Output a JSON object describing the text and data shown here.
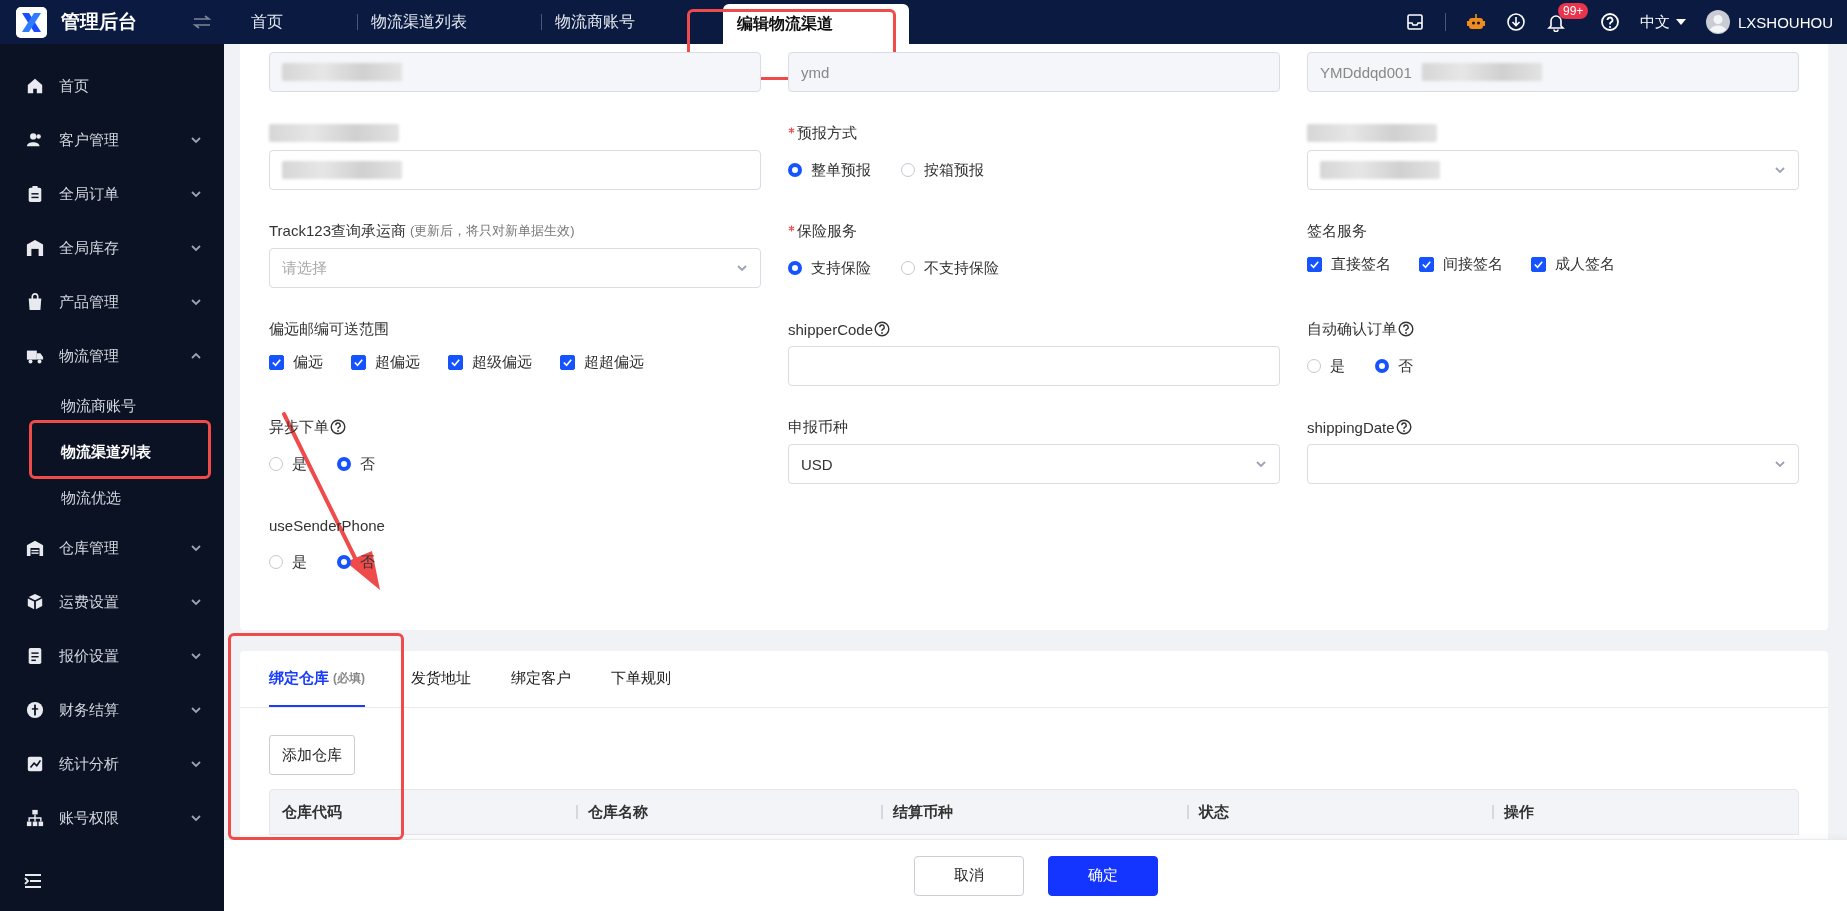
{
  "topbar": {
    "app_name": "管理后台",
    "tabs": [
      {
        "label": "首页",
        "selected": false
      },
      {
        "label": "物流渠道列表",
        "selected": false
      },
      {
        "label": "物流商账号",
        "selected": false
      },
      {
        "label": "编辑物流渠道",
        "selected": true
      }
    ],
    "notification_badge": "99+",
    "language": "中文",
    "username": "LXSHOUHOU"
  },
  "sidebar": {
    "items": [
      {
        "label": "首页",
        "kind": "link"
      },
      {
        "label": "客户管理",
        "kind": "group",
        "expanded": false
      },
      {
        "label": "全局订单",
        "kind": "group",
        "expanded": false
      },
      {
        "label": "全局库存",
        "kind": "group",
        "expanded": false
      },
      {
        "label": "产品管理",
        "kind": "group",
        "expanded": false
      },
      {
        "label": "物流管理",
        "kind": "group",
        "expanded": true,
        "children": [
          {
            "label": "物流商账号",
            "selected": false
          },
          {
            "label": "物流渠道列表",
            "selected": true
          },
          {
            "label": "物流优选",
            "selected": false
          }
        ]
      },
      {
        "label": "仓库管理",
        "kind": "group",
        "expanded": false
      },
      {
        "label": "运费设置",
        "kind": "group",
        "expanded": false
      },
      {
        "label": "报价设置",
        "kind": "group",
        "expanded": false
      },
      {
        "label": "财务结算",
        "kind": "group",
        "expanded": false
      },
      {
        "label": "统计分析",
        "kind": "group",
        "expanded": false
      },
      {
        "label": "账号权限",
        "kind": "group",
        "expanded": false
      }
    ]
  },
  "form": {
    "fields": [
      {
        "kind": "input",
        "disabled": true,
        "redacted": true
      },
      {
        "kind": "input",
        "disabled": true,
        "value": "ymd"
      },
      {
        "kind": "input",
        "disabled": true,
        "value": "YMDddqd001",
        "redacted": true
      },
      {
        "kind": "input",
        "label_redacted": true,
        "redacted": true
      },
      {
        "kind": "radio",
        "label": "预报方式",
        "required": true,
        "options": [
          {
            "label": "整单预报",
            "selected": true
          },
          {
            "label": "按箱预报",
            "selected": false
          }
        ]
      },
      {
        "kind": "select",
        "label_redacted": true,
        "redacted": true
      },
      {
        "kind": "select",
        "label": "Track123查询承运商",
        "hint": "(更新后，将只对新单据生效)",
        "placeholder": "请选择"
      },
      {
        "kind": "radio",
        "label": "保险服务",
        "required": true,
        "options": [
          {
            "label": "支持保险",
            "selected": true
          },
          {
            "label": "不支持保险",
            "selected": false
          }
        ]
      },
      {
        "kind": "checkbox",
        "label": "签名服务",
        "options": [
          {
            "label": "直接签名",
            "checked": true
          },
          {
            "label": "间接签名",
            "checked": true
          },
          {
            "label": "成人签名",
            "checked": true
          }
        ]
      },
      {
        "kind": "checkbox",
        "label": "偏远邮编可送范围",
        "options": [
          {
            "label": "偏远",
            "checked": true
          },
          {
            "label": "超偏远",
            "checked": true
          },
          {
            "label": "超级偏远",
            "checked": true
          },
          {
            "label": "超超偏远",
            "checked": true
          }
        ]
      },
      {
        "kind": "input",
        "label": "shipperCode",
        "help": true
      },
      {
        "kind": "radio",
        "label": "自动确认订单",
        "help": true,
        "options": [
          {
            "label": "是",
            "selected": false
          },
          {
            "label": "否",
            "selected": true
          }
        ]
      },
      {
        "kind": "radio",
        "label": "异步下单",
        "help": true,
        "options": [
          {
            "label": "是",
            "selected": false
          },
          {
            "label": "否",
            "selected": true
          }
        ]
      },
      {
        "kind": "select",
        "label": "申报币种",
        "value": "USD"
      },
      {
        "kind": "select",
        "label": "shippingDate",
        "help": true
      },
      {
        "kind": "radio",
        "label": "useSenderPhone",
        "options": [
          {
            "label": "是",
            "selected": false
          },
          {
            "label": "否",
            "selected": true
          }
        ]
      }
    ]
  },
  "binding": {
    "tabs": [
      {
        "label": "绑定仓库",
        "note": "(必填)",
        "selected": true
      },
      {
        "label": "发货地址",
        "selected": false
      },
      {
        "label": "绑定客户",
        "selected": false
      },
      {
        "label": "下单规则",
        "selected": false
      }
    ],
    "add_button": "添加仓库",
    "table": {
      "columns": [
        "仓库代码",
        "仓库名称",
        "结算币种",
        "状态",
        "操作"
      ]
    }
  },
  "footer": {
    "buttons": [
      {
        "label": "取消",
        "kind": "default"
      },
      {
        "label": "确定",
        "kind": "primary"
      }
    ]
  }
}
